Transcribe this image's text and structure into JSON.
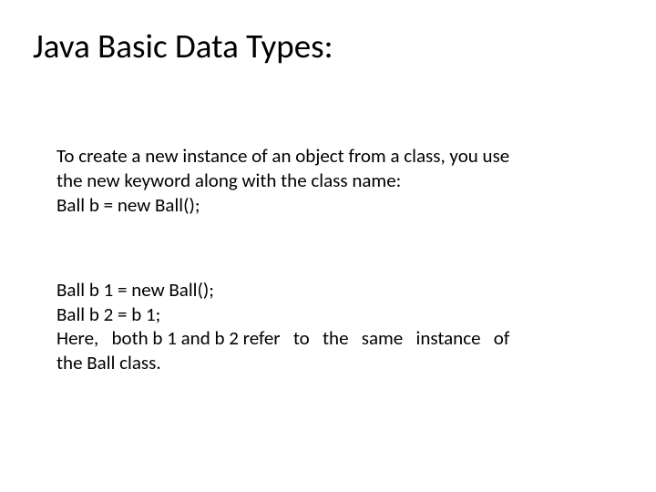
{
  "title": "Java Basic Data Types:",
  "para1_line1": "To create a new instance of an object from a class, you use",
  "para1_line2": "the new keyword along with the class name:",
  "para1_line3": "Ball b = new Ball();",
  "para2_line1": "Ball b 1 = new Ball();",
  "para2_line2": "Ball b 2 = b 1;",
  "para2_line3": "Here,   both b 1 and b 2 refer   to   the   same   instance   of",
  "para2_line4": "the Ball class."
}
